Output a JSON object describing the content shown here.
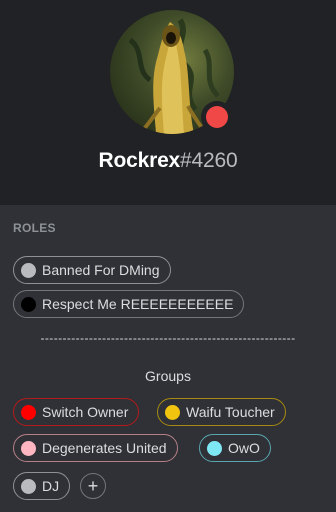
{
  "profile": {
    "username": "Rockrex",
    "discriminator": "#4260",
    "status_color": "#f04747",
    "avatar_icon": "hooded-figure-avatar"
  },
  "roles_section": {
    "title": "ROLES",
    "divider": "----------------------------------------------------------",
    "groups_label": "Groups",
    "add_icon": "plus-icon",
    "add_symbol": "+"
  },
  "roles": [
    {
      "name": "Banned For DMing",
      "dot_color": "#b9bbbe",
      "border_color": "#8e9297"
    },
    {
      "name": "Respect Me REEEEEEEEEEE",
      "dot_color": "#000000",
      "border_color": "#72767d"
    },
    {
      "name": "Switch Owner",
      "dot_color": "#ff0000",
      "border_color": "#b31b1b"
    },
    {
      "name": "Waifu Toucher",
      "dot_color": "#f1c40f",
      "border_color": "#a88a10"
    },
    {
      "name": "Degenerates United",
      "dot_color": "#ffb6c1",
      "border_color": "#b58088"
    },
    {
      "name": "OwO",
      "dot_color": "#7fe8f5",
      "border_color": "#5aa5ae"
    },
    {
      "name": "DJ",
      "dot_color": "#b9bbbe",
      "border_color": "#8e9297"
    }
  ]
}
